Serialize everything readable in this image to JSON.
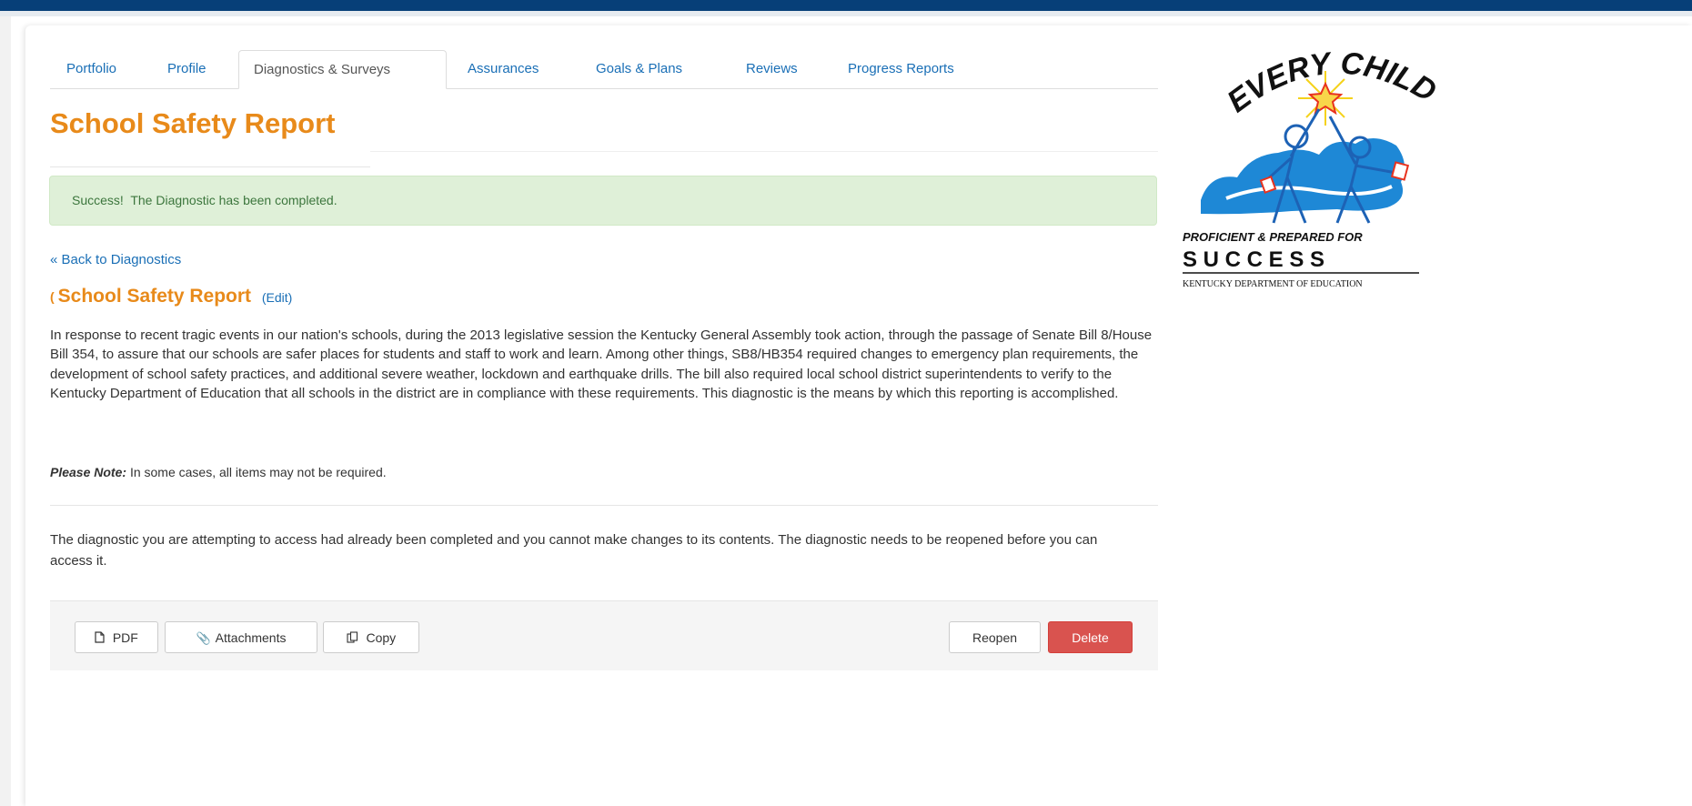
{
  "tabs": [
    {
      "label": "Portfolio"
    },
    {
      "label": "Profile"
    },
    {
      "label": "Diagnostics & Surveys"
    },
    {
      "label": "Assurances"
    },
    {
      "label": "Goals & Plans"
    },
    {
      "label": "Reviews"
    },
    {
      "label": "Progress Reports"
    }
  ],
  "active_tab": "Diagnostics & Surveys",
  "page_title": "School Safety Report",
  "alert": {
    "strong": "Success!",
    "text": "The Diagnostic has been completed."
  },
  "back_link": "« Back to Diagnostics",
  "section": {
    "marker": "(",
    "title": "School Safety Report",
    "edit_label": "(Edit)"
  },
  "description": "In response to recent tragic events in our nation's schools, during the 2013 legislative session the Kentucky General Assembly took action, through the passage of Senate Bill 8/House Bill 354, to assure that our schools are safer places for students and staff to work and learn. Among other things, SB8/HB354 required changes to emergency plan requirements, the development of school safety practices, and additional severe weather, lockdown and earthquake drills. The bill also required local school district superintendents to verify to the Kentucky Department of Education that all schools in the district are in compliance with these requirements. This diagnostic is the means by which this reporting is accomplished.",
  "note": {
    "label": "Please Note:",
    "text": "In some cases, all items may not be required."
  },
  "locked_message": "The diagnostic you are attempting to access had already been completed and you cannot make changes to its contents. The diagnostic needs to be reopened before you can access it.",
  "actions": {
    "pdf": {
      "label": "PDF",
      "icon": "file-icon"
    },
    "attachments": {
      "label": "Attachments",
      "icon": "paperclip-icon"
    },
    "copy": {
      "label": "Copy",
      "icon": "copy-icon"
    },
    "reopen": {
      "label": "Reopen"
    },
    "delete": {
      "label": "Delete"
    }
  },
  "logo": {
    "top_text": "EVERY CHILD",
    "line1": "PROFICIENT & PREPARED FOR",
    "line2": "S U C C E S S",
    "line3": "KENTUCKY DEPARTMENT OF EDUCATION"
  },
  "colors": {
    "top_bar": "#073f78",
    "accent_orange": "#e88a1a",
    "link_blue": "#1a6fb6",
    "success_bg": "#dff0d8",
    "success_text": "#3c763d",
    "danger": "#d9534f",
    "logo_blue": "#1e88d6"
  }
}
